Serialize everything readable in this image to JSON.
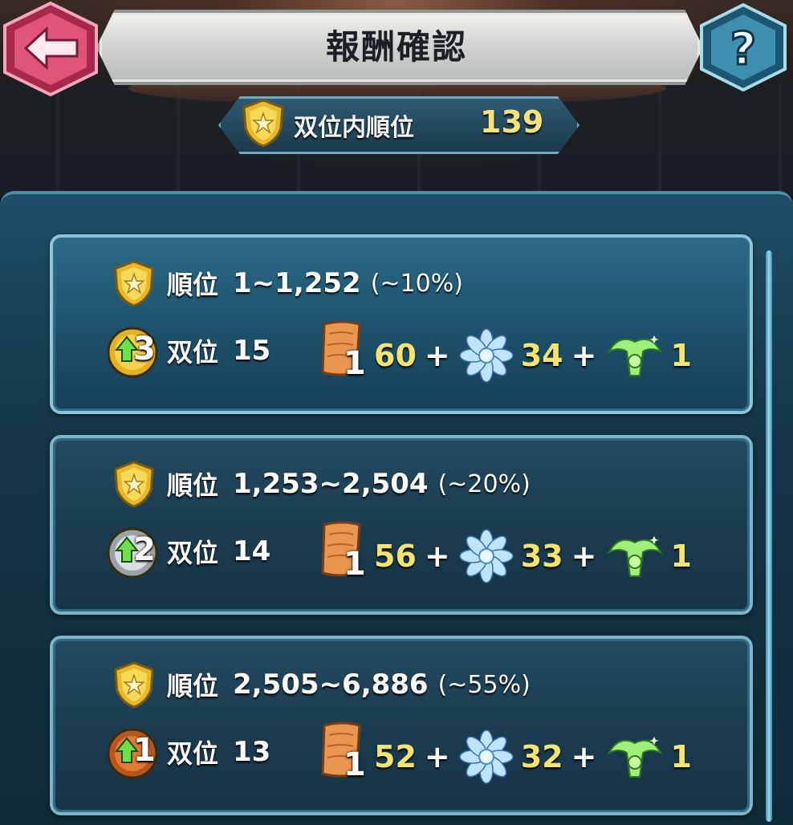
{
  "header": {
    "title": "報酬確認",
    "back_icon": "back-arrow-icon",
    "help_icon": "help-question-icon",
    "help_glyph": "?"
  },
  "rank": {
    "label": "双位内順位",
    "value": "139",
    "icon": "gold-shield-icon"
  },
  "colors": {
    "gold_text": "#f4e36e",
    "panel": "#1e4e66",
    "card_border": "#8cc4d8",
    "back_button": "#e0547a",
    "help_button": "#3f8fb0"
  },
  "tiers": [
    {
      "rank_label": "順位",
      "range": "1~1,252",
      "percent": "(~10%)",
      "medal": "gold",
      "medal_num": "3",
      "tier_label": "双位",
      "tier_value": "15",
      "scroll_count": "1",
      "scroll_amount": "60",
      "flower_amount": "34",
      "crest_amount": "1"
    },
    {
      "rank_label": "順位",
      "range": "1,253~2,504",
      "percent": "(~20%)",
      "medal": "silver",
      "medal_num": "2",
      "tier_label": "双位",
      "tier_value": "14",
      "scroll_count": "1",
      "scroll_amount": "56",
      "flower_amount": "33",
      "crest_amount": "1"
    },
    {
      "rank_label": "順位",
      "range": "2,505~6,886",
      "percent": "(~55%)",
      "medal": "bronze",
      "medal_num": "1",
      "tier_label": "双位",
      "tier_value": "13",
      "scroll_count": "1",
      "scroll_amount": "52",
      "flower_amount": "32",
      "crest_amount": "1"
    }
  ],
  "plus_sign": "+"
}
